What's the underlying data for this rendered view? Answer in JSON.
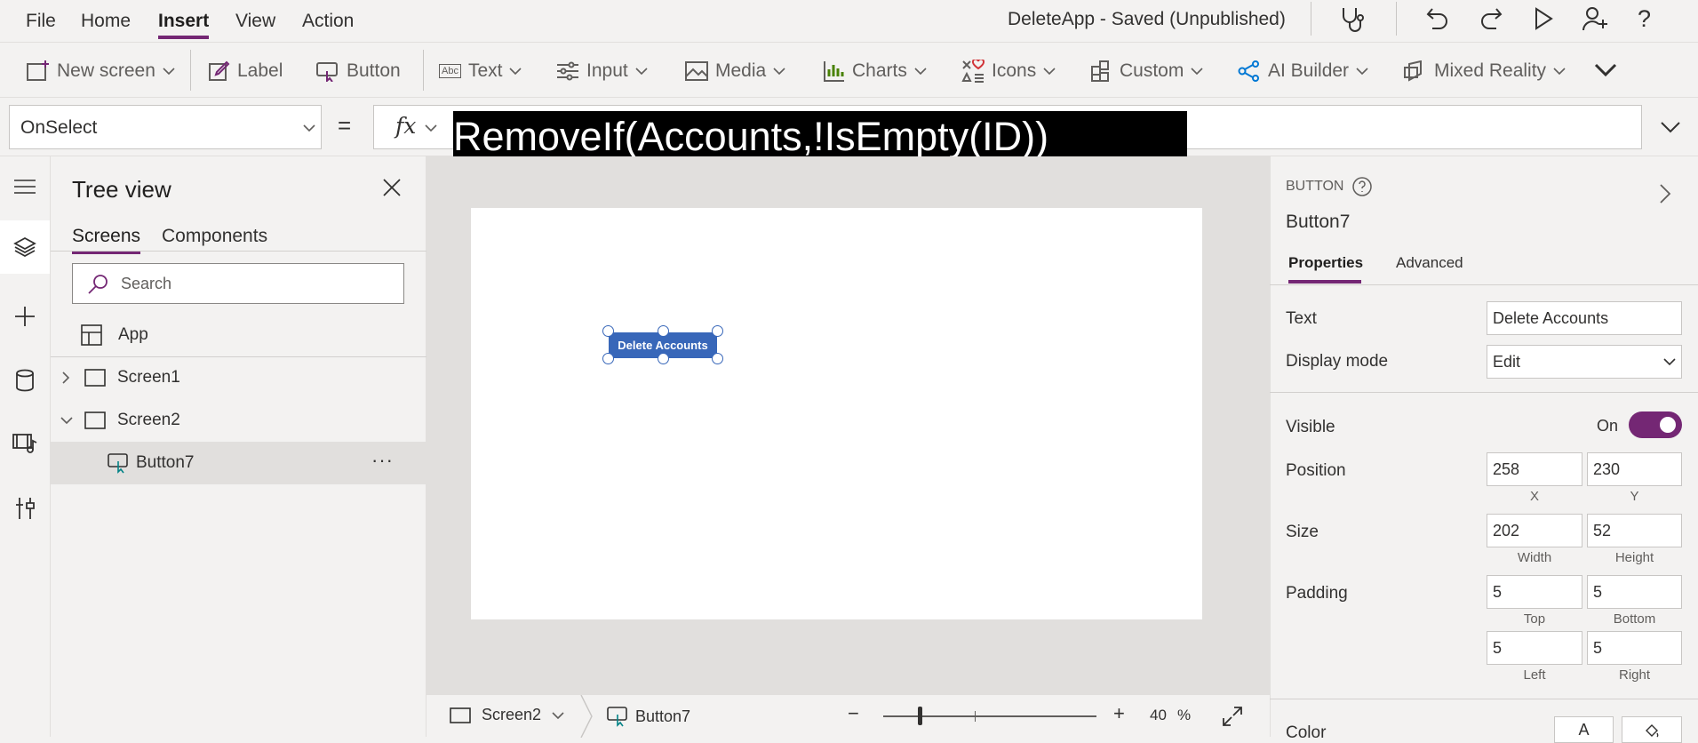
{
  "menu": {
    "items": [
      "File",
      "Home",
      "Insert",
      "View",
      "Action"
    ],
    "active": "Insert",
    "app_title": "DeleteApp - Saved (Unpublished)"
  },
  "toolbar": {
    "icons": [
      "stethoscope-icon",
      "undo-icon",
      "redo-icon",
      "play-icon",
      "share-user-icon",
      "help-icon"
    ],
    "help_label": "?"
  },
  "ribbon": {
    "new_screen": "New screen",
    "label": "Label",
    "button": "Button",
    "text": "Text",
    "input": "Input",
    "media": "Media",
    "charts": "Charts",
    "icons": "Icons",
    "custom": "Custom",
    "ai_builder": "AI Builder",
    "mixed_reality": "Mixed Reality",
    "text_icon_label": "Abc"
  },
  "formula": {
    "property": "OnSelect",
    "equals": "=",
    "fx": "fx",
    "expression": "RemoveIf(Accounts,!IsEmpty(ID))"
  },
  "tree": {
    "title": "Tree view",
    "tabs": [
      "Screens",
      "Components"
    ],
    "search_placeholder": "Search",
    "items": [
      {
        "label": "App"
      },
      {
        "label": "Screen1"
      },
      {
        "label": "Screen2"
      },
      {
        "label": "Button7"
      }
    ],
    "more": "···"
  },
  "canvas": {
    "button_text": "Delete Accounts"
  },
  "status": {
    "screen": "Screen2",
    "control": "Button7",
    "zoom_minus": "−",
    "zoom_plus": "+",
    "zoom_value": "40",
    "zoom_unit": "%",
    "zoom_fraction": 0.4
  },
  "properties": {
    "type": "BUTTON",
    "name": "Button7",
    "tabs": [
      "Properties",
      "Advanced"
    ],
    "text_label": "Text",
    "text_value": "Delete Accounts",
    "display_mode_label": "Display mode",
    "display_mode_value": "Edit",
    "visible_label": "Visible",
    "visible_state": "On",
    "position_label": "Position",
    "position_x": "258",
    "position_y": "230",
    "x_caption": "X",
    "y_caption": "Y",
    "size_label": "Size",
    "width": "202",
    "height": "52",
    "width_caption": "Width",
    "height_caption": "Height",
    "padding_label": "Padding",
    "pad_top": "5",
    "pad_bottom": "5",
    "pad_left": "5",
    "pad_right": "5",
    "top_caption": "Top",
    "bottom_caption": "Bottom",
    "left_caption": "Left",
    "right_caption": "Right",
    "color_label": "Color",
    "color_font_letter": "A"
  },
  "colors": {
    "accent": "#742774",
    "button_fill": "#3867b9"
  }
}
